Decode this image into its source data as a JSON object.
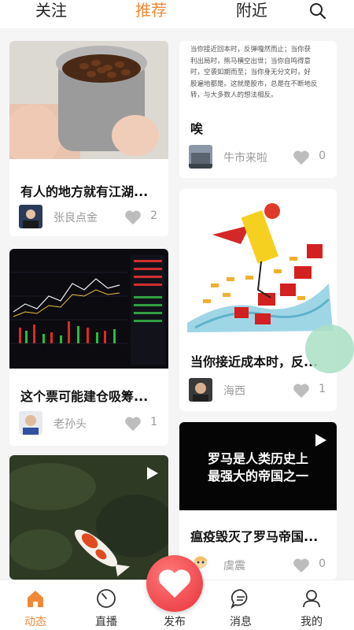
{
  "tabs": [
    "关注",
    "推荐",
    "附近"
  ],
  "active_tab": "推荐",
  "cards": {
    "c1": {
      "title": "有人的地方就有江湖...",
      "author": "张良点金",
      "likes": "2"
    },
    "c2": {
      "excerpt": [
        "当你接近回本时，反弹嘎然而止；当你获",
        "利出局时，熊马横空出世；当你自鸣得意",
        "时，空袭如期而至；当你身无分文时，好",
        "股遍地都是。这就是股市，总是在不断地反",
        "转，与大多数人的想法相反。"
      ],
      "title": "唉",
      "author": "牛市来啦",
      "likes": "0"
    },
    "c3": {
      "title": "当你接近成本时，反...",
      "author": "海西",
      "likes": "1"
    },
    "c4": {
      "title": "这个票可能建仓吸筹...",
      "author": "老孙头",
      "likes": "1"
    },
    "c5": {
      "image_text": [
        "罗马是人类历史上",
        "最强大的帝国之一"
      ],
      "title": "瘟疫毁灭了罗马帝国...",
      "author": "虞震",
      "likes": "0"
    },
    "c6": {}
  },
  "bottom_nav": [
    {
      "label": "动态",
      "icon": "home-icon",
      "active": true
    },
    {
      "label": "直播",
      "icon": "gauge-icon",
      "active": false
    },
    {
      "label": "发布",
      "icon": "heart-icon",
      "active": false
    },
    {
      "label": "消息",
      "icon": "message-icon",
      "active": false
    },
    {
      "label": "我的",
      "icon": "profile-icon",
      "active": false
    }
  ],
  "colors": {
    "accent": "#ee8a3a",
    "publish": "#e8313a",
    "bubble": "#a9dfc4"
  }
}
